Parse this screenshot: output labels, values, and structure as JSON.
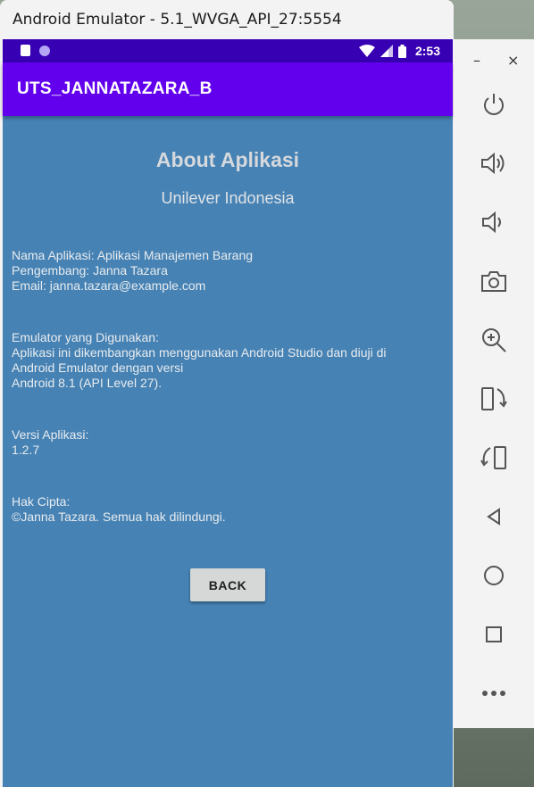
{
  "window": {
    "title": "Android Emulator - 5.1_WVGA_API_27:5554"
  },
  "status_bar": {
    "time": "2:53",
    "icons": [
      "sd-card-icon",
      "notification-dot-icon",
      "wifi-icon",
      "signal-icon",
      "battery-icon"
    ]
  },
  "app_bar": {
    "title": "UTS_JANNATAZARA_B",
    "color": "#6200ee"
  },
  "content": {
    "heading": "About Aplikasi",
    "subheading": "Unilever Indonesia",
    "info": {
      "line1": "Nama Aplikasi: Aplikasi Manajemen Barang",
      "line2": "Pengembang: Janna Tazara",
      "line3": "Email: janna.tazara@example.com"
    },
    "emulator": {
      "line1": "Emulator yang Digunakan:",
      "line2": "Aplikasi ini dikembangkan menggunakan Android Studio dan diuji di",
      "line3": "Android Emulator dengan versi",
      "line4": "Android 8.1 (API Level 27)."
    },
    "version": {
      "line1": "Versi Aplikasi:",
      "line2": "1.2.7"
    },
    "copyright": {
      "line1": "Hak Cipta:",
      "line2": "©Janna Tazara. Semua hak dilindungi."
    },
    "back_label": "BACK",
    "background": "#4682b4"
  },
  "toolbar": {
    "minimize": "–",
    "close": "×",
    "items": [
      "power-icon",
      "volume-up-icon",
      "volume-down-icon",
      "camera-icon",
      "zoom-icon",
      "rotate-left-icon",
      "rotate-right-icon",
      "back-icon",
      "home-icon",
      "overview-icon",
      "more-icon"
    ]
  }
}
